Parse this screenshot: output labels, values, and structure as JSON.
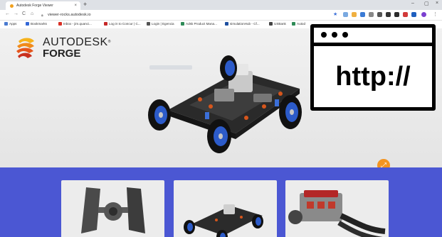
{
  "browser": {
    "tab_title": "Autodesk Forge Viewer",
    "tab_close": "×",
    "new_tab": "+",
    "window_controls": [
      "–",
      "▢",
      "×"
    ],
    "url": "viewer-rocks.autodesk.io",
    "nav": {
      "back": "←",
      "forward": "→",
      "reload": "C",
      "home": "⌂"
    },
    "star": "★"
  },
  "bookmarks": [
    {
      "label": "Apps",
      "icon": "apps-grid-icon",
      "color": "#4a7bd0"
    },
    {
      "label": "Bookmarks",
      "icon": "star-icon",
      "color": "#3367d6"
    },
    {
      "label": "Inbox - jim.quanci...",
      "icon": "gmail-icon",
      "color": "#d93025"
    },
    {
      "label": "Log in to Concur | C...",
      "icon": "concur-icon",
      "color": "#c62828"
    },
    {
      "label": "Login | Egencia",
      "icon": "egencia-icon",
      "color": "#555555"
    },
    {
      "label": "Adsk Product Mana...",
      "icon": "autodesk-icon",
      "color": "#2e8b57"
    },
    {
      "label": "simulationHub - Cf...",
      "icon": "simhub-icon",
      "color": "#1e4fa0"
    },
    {
      "label": "USBank",
      "icon": "usbank-icon",
      "color": "#444444"
    },
    {
      "label": "Autod",
      "icon": "autodesk-icon",
      "color": "#2e8b57"
    }
  ],
  "page": {
    "brand_line1": "AUTODESK",
    "brand_registered": "®",
    "brand_line2": "FORGE",
    "expand_icon": "⤢"
  },
  "overlay": {
    "text": "http://"
  },
  "colors": {
    "frame_blue": "#1e90d6",
    "gallery_blue": "#4b57d3",
    "accent_orange": "#f39420"
  }
}
